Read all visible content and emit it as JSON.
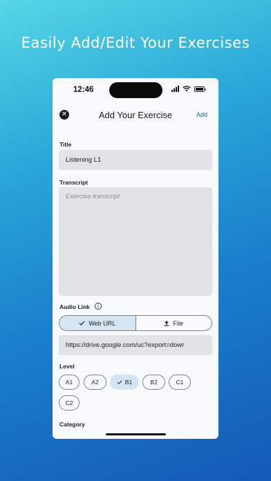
{
  "headline": "Easily Add/Edit Your Exercises",
  "status_bar": {
    "time": "12:46"
  },
  "nav": {
    "title": "Add Your Exercise",
    "add_label": "Add",
    "close_icon": "close-icon"
  },
  "form": {
    "title_label": "Title",
    "title_value": "Listening L1",
    "transcript_label": "Transcript",
    "transcript_placeholder": "Exercise transcript",
    "audio_label": "Audio Link",
    "audio_options": [
      {
        "label": "Web URL",
        "icon": "check-icon",
        "selected": true
      },
      {
        "label": "File",
        "icon": "upload-icon",
        "selected": false
      }
    ],
    "audio_url": "https://drive.google.com/uc?export=dowr",
    "level_label": "Level",
    "levels": [
      "A1",
      "A2",
      "B1",
      "B2",
      "C1",
      "C2"
    ],
    "selected_level": "B1",
    "category_label": "Category"
  },
  "colors": {
    "accent": "#1a5d80",
    "selected_bg": "#d3e4f3",
    "field_bg": "#e1e3e5"
  }
}
